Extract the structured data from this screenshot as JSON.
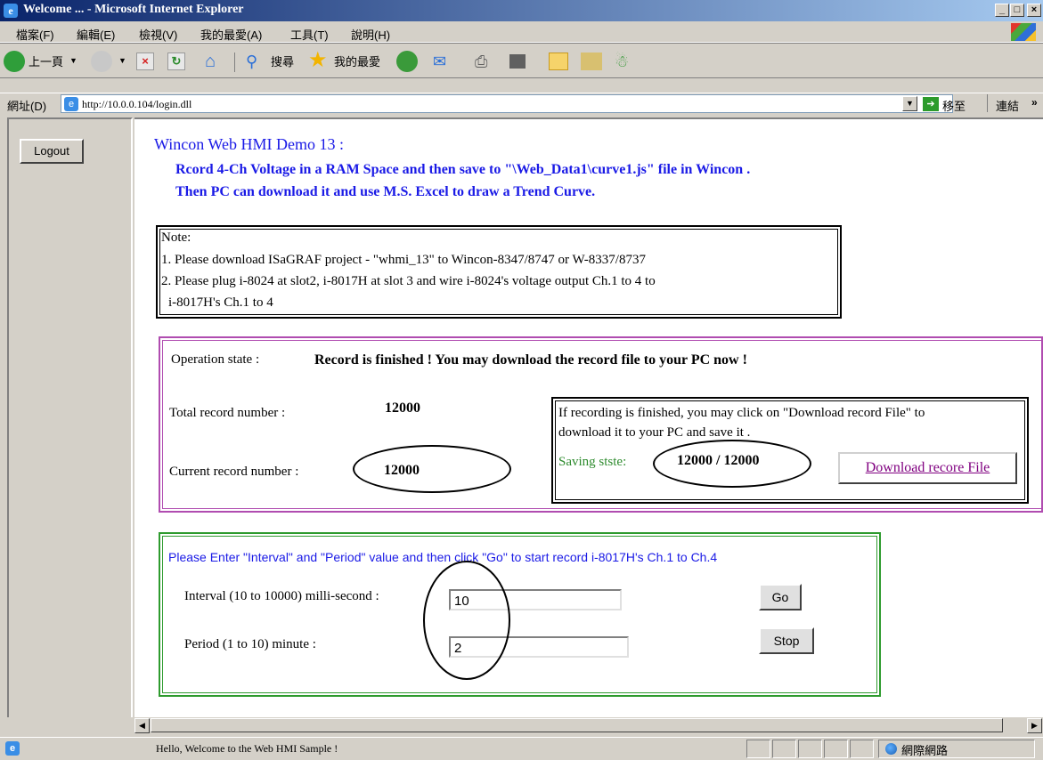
{
  "window": {
    "title": "Welcome ... - Microsoft Internet Explorer"
  },
  "menu": {
    "items": [
      "檔案(F)",
      "編輯(E)",
      "檢視(V)",
      "我的最愛(A)",
      "工具(T)",
      "說明(H)"
    ]
  },
  "toolbar": {
    "back_label": "上一頁",
    "search_label": "搜尋",
    "favorites_label": "我的最愛"
  },
  "address": {
    "label": "網址(D)",
    "url": "http://10.0.0.104/login.dll",
    "go_label": "移至",
    "links_label": "連結"
  },
  "left": {
    "logout_label": "Logout"
  },
  "header": {
    "title": "Wincon Web HMI Demo 13 :",
    "line1": "Rcord 4-Ch Voltage in  a RAM  Space and then save to \"\\Web_Data1\\curve1.js\" file in Wincon .",
    "line2": "Then PC can download it and use M.S. Excel to draw a Trend Curve."
  },
  "note": {
    "heading": "Note:",
    "line1": "1. Please download ISaGRAF project - \"whmi_13\" to Wincon-8347/8747 or W-8337/8737",
    "line2": "2. Please plug i-8024 at slot2, i-8017H at slot 3 and wire i-8024's voltage output Ch.1 to 4 to",
    "line3": "i-8017H's Ch.1 to 4"
  },
  "operation": {
    "state_label": "Operation state :",
    "state_value": "Record is finished ! You may download the record file to your PC now !",
    "total_label": "Total record number :",
    "total_value": "12000",
    "current_label": "Current record number :",
    "current_value": "12000",
    "download_text1": "If recording is finished, you may click on \"Download record File\" to",
    "download_text2": "download it to your PC and save it .",
    "saving_label": "Saving stste:",
    "saving_value": "12000 / 12000",
    "download_button": "Download recore File"
  },
  "record": {
    "instruction": "Please Enter \"Interval\" and \"Period\" value and then click \"Go\" to start record i-8017H's Ch.1 to Ch.4",
    "interval_label": "Interval  (10 to 10000) milli-second :",
    "interval_value": "10",
    "period_label": "Period (1 to 10) minute :",
    "period_value": "2",
    "go_label": "Go",
    "stop_label": "Stop"
  },
  "status": {
    "text": "Hello, Welcome to the Web HMI Sample !",
    "zone": "網際網路"
  },
  "colors": {
    "heading_blue": "#1a1ae6",
    "saving_green": "#2e8b2e",
    "operation_border": "#b04cb0",
    "record_border": "#2e9b2e"
  }
}
